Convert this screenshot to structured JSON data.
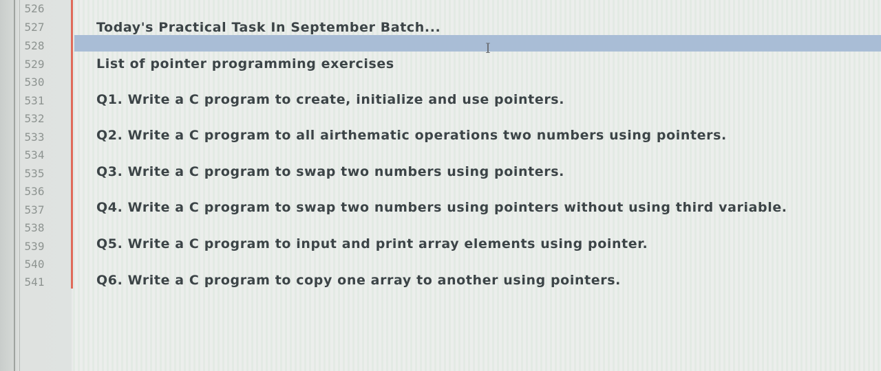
{
  "gutter": {
    "line_numbers": [
      "526",
      "527",
      "528",
      "529",
      "530",
      "531",
      "532",
      "533",
      "534",
      "535",
      "536",
      "537",
      "538",
      "539",
      "540",
      "541"
    ]
  },
  "editor": {
    "lines": [
      "Today's Practical Task In September Batch...",
      "",
      "List of pointer programming exercises",
      "",
      "Q1. Write a C program to create, initialize and use pointers.",
      "",
      "Q2. Write a C program to all airthematic operations two numbers using pointers.",
      "",
      "Q3. Write a C program to swap two numbers using pointers.",
      "",
      "Q4. Write a C program to swap two numbers using pointers without using third variable.",
      "",
      "Q5. Write a C program to input and print array elements using pointer.",
      "",
      "Q6. Write a C program to copy one array to another using pointers."
    ],
    "cursor_icon": "text-cursor-icon",
    "current_line_color": "#a9bdd6",
    "modified_marker_color": "#e06a5a"
  }
}
